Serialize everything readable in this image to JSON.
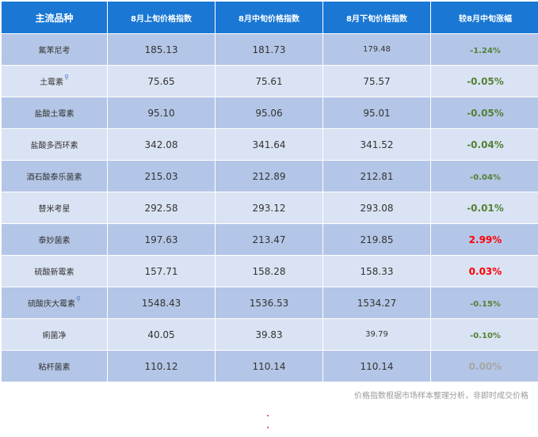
{
  "table": {
    "headers": [
      "主流品种",
      "8月上旬价格指数",
      "8月中旬价格指数",
      "8月下旬价格指数",
      "较8月中旬涨幅"
    ],
    "rows": [
      {
        "name": "氟苯尼考",
        "search": false,
        "c1": "185.13",
        "c2": "181.73",
        "c3": "179.48",
        "change": "-1.24%"
      },
      {
        "name": "土霉素",
        "search": true,
        "c1": "75.65",
        "c2": "75.61",
        "c3": "75.57",
        "change": "-0.05%"
      },
      {
        "name": "盐酸土霉素",
        "search": false,
        "c1": "95.10",
        "c2": "95.06",
        "c3": "95.01",
        "change": "-0.05%"
      },
      {
        "name": "盐酸多西环素",
        "search": false,
        "c1": "342.08",
        "c2": "341.64",
        "c3": "341.52",
        "change": "-0.04%"
      },
      {
        "name": "酒石酸泰乐菌素",
        "search": false,
        "c1": "215.03",
        "c2": "212.89",
        "c3": "212.81",
        "change": "-0.04%"
      },
      {
        "name": "替米考星",
        "search": false,
        "c1": "292.58",
        "c2": "293.12",
        "c3": "293.08",
        "change": "-0.01%"
      },
      {
        "name": "泰妙菌素",
        "search": false,
        "c1": "197.63",
        "c2": "213.47",
        "c3": "219.85",
        "change": "2.99%"
      },
      {
        "name": "硫酸新霉素",
        "search": false,
        "c1": "157.71",
        "c2": "158.28",
        "c3": "158.33",
        "change": "0.03%"
      },
      {
        "name": "硫酸庆大霉素",
        "search": true,
        "c1": "1548.43",
        "c2": "1536.53",
        "c3": "1534.27",
        "change": "-0.15%"
      },
      {
        "name": "痢菌净",
        "search": false,
        "c1": "40.05",
        "c2": "39.83",
        "c3": "39.79",
        "change": "-0.10%"
      },
      {
        "name": "粘杆菌素",
        "search": false,
        "c1": "110.12",
        "c2": "110.14",
        "c3": "110.14",
        "change": "0.00%"
      }
    ]
  },
  "footnote": "价格指数根据市场样本整理分析，非即时成交价格",
  "colors": {
    "header_bg": "#1a78d4",
    "row_dark": "#b4c6e7",
    "row_light": "#dae3f3",
    "negative": "#538135",
    "positive": "#ff0000",
    "zero": "#a6a6a6"
  },
  "icons": {
    "search": "magnifier-icon"
  }
}
